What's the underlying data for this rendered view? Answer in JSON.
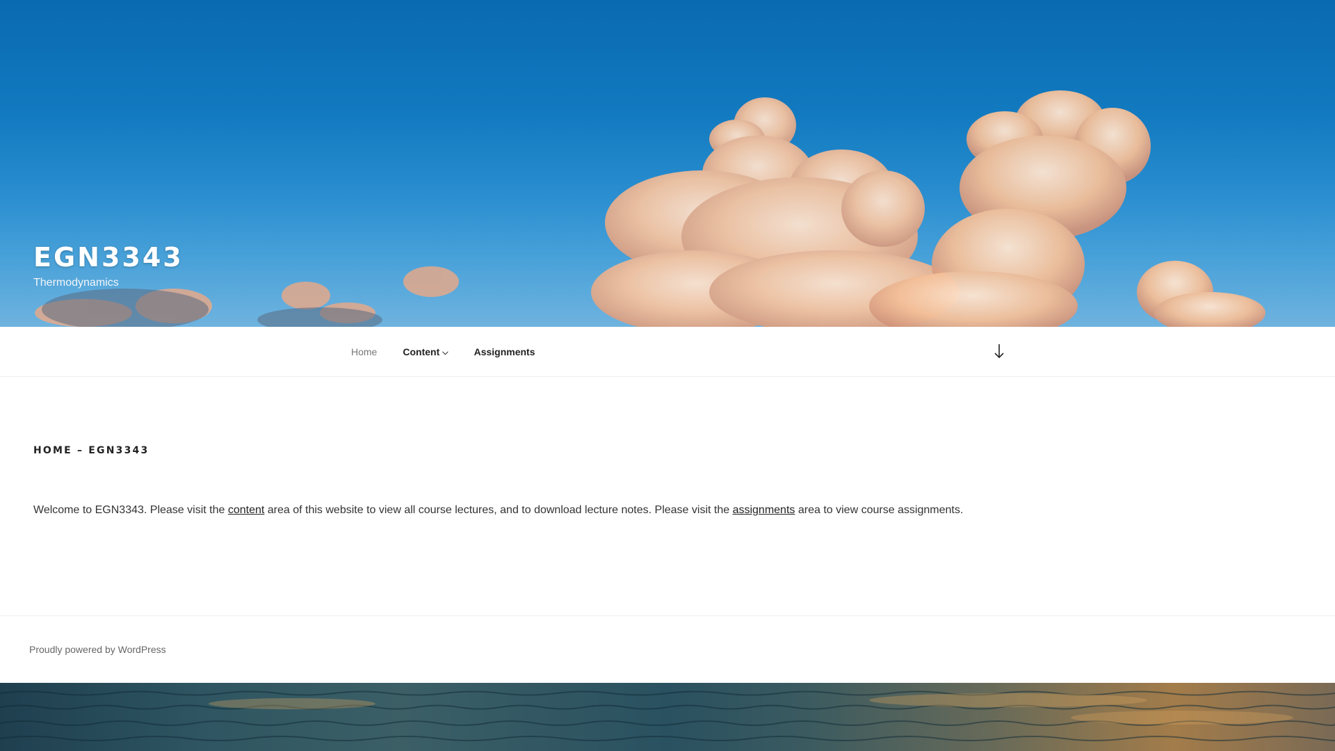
{
  "header": {
    "site_title": "EGN3343",
    "site_description": "Thermodynamics"
  },
  "nav": {
    "items": [
      {
        "label": "Home"
      },
      {
        "label": "Content"
      },
      {
        "label": "Assignments"
      }
    ],
    "scroll_icon": "arrow-down-icon",
    "dropdown_icon": "chevron-down-icon"
  },
  "page": {
    "title": "HOME – EGN3343",
    "body_before_content": "Welcome to EGN3343. Please visit the ",
    "content_link": "content",
    "body_middle": " area of this website to view all course lectures, and to download lecture notes. Please visit the ",
    "assignments_link": "assignments",
    "body_after": " area to view course assignments."
  },
  "footer": {
    "credit": "Proudly powered by WordPress"
  }
}
